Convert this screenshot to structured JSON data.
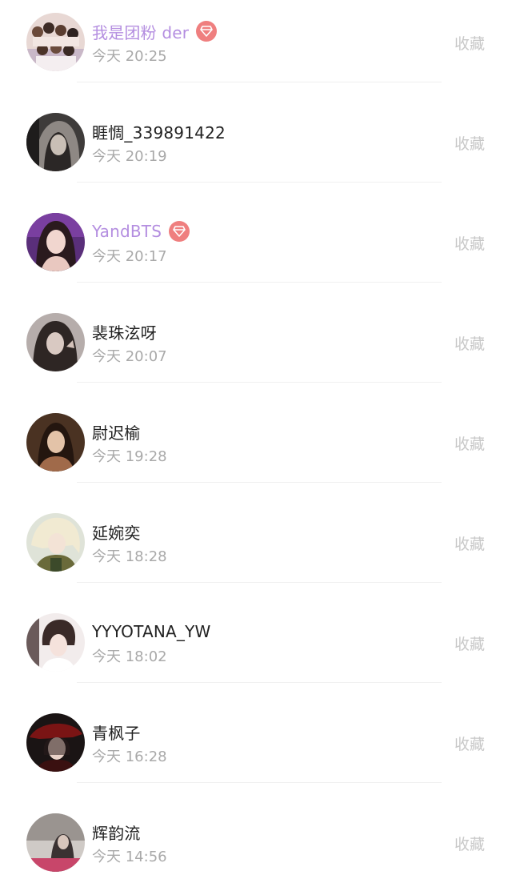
{
  "items": [
    {
      "name": "我是团粉 der",
      "time": "今天 20:25",
      "action": "收藏",
      "member": true,
      "avatar": "group-photo"
    },
    {
      "name": "睚惆_339891422",
      "time": "今天 20:19",
      "action": "收藏",
      "member": false,
      "avatar": "hooded-girl"
    },
    {
      "name": "YandBTS",
      "time": "今天 20:17",
      "action": "收藏",
      "member": true,
      "avatar": "girl-purple"
    },
    {
      "name": "裴珠泫呀",
      "time": "今天 20:07",
      "action": "收藏",
      "member": false,
      "avatar": "girl-grey"
    },
    {
      "name": "尉迟榆",
      "time": "今天 19:28",
      "action": "收藏",
      "member": false,
      "avatar": "girl-portrait"
    },
    {
      "name": "延婉奕",
      "time": "今天 18:28",
      "action": "收藏",
      "member": false,
      "avatar": "anime-blond"
    },
    {
      "name": "YYYOTANA_YW",
      "time": "今天 18:02",
      "action": "收藏",
      "member": false,
      "avatar": "boy-portrait"
    },
    {
      "name": "青枫子",
      "time": "今天 16:28",
      "action": "收藏",
      "member": false,
      "avatar": "anime-red-hat"
    },
    {
      "name": "辉韵流",
      "time": "今天 14:56",
      "action": "收藏",
      "member": false,
      "avatar": "street-photo"
    }
  ],
  "colors": {
    "member_name": "#b48ee0",
    "name": "#222222",
    "time": "#a9a9a9",
    "action": "#c8c8c8",
    "vip_badge": "#ef7f7f"
  }
}
